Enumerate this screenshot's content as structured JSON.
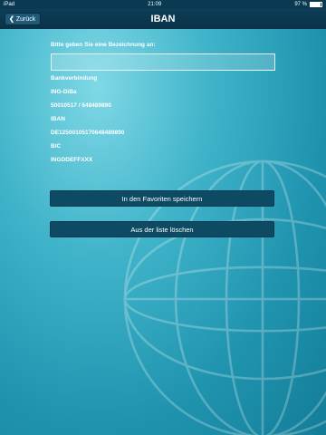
{
  "statusbar": {
    "carrier": "iPad",
    "time": "21:09",
    "battery": "97 %"
  },
  "navbar": {
    "title": "IBAN",
    "back_label": "Zurück"
  },
  "form": {
    "prompt": "Bitte geben Sie eine Bezeichnung an:",
    "name_value": "",
    "name_placeholder": ""
  },
  "details": {
    "bank_label": "Bankverbindung",
    "bank_name": "ING-DiBa",
    "bank_numbers": "50010517 / 648489890",
    "iban_label": "IBAN",
    "iban_value": "DE12500105170648489890",
    "bic_label": "BIC",
    "bic_value": "INGDDEFFXXX"
  },
  "actions": {
    "save_favorites": "In den Favoriten speichern",
    "delete_from_list": "Aus der liste löschen"
  },
  "colors": {
    "navbar": "#0a3248",
    "button": "#0d4a63",
    "background": "#2aa3bb"
  },
  "icons": {
    "back": "chevron-left-icon",
    "battery": "battery-icon"
  }
}
